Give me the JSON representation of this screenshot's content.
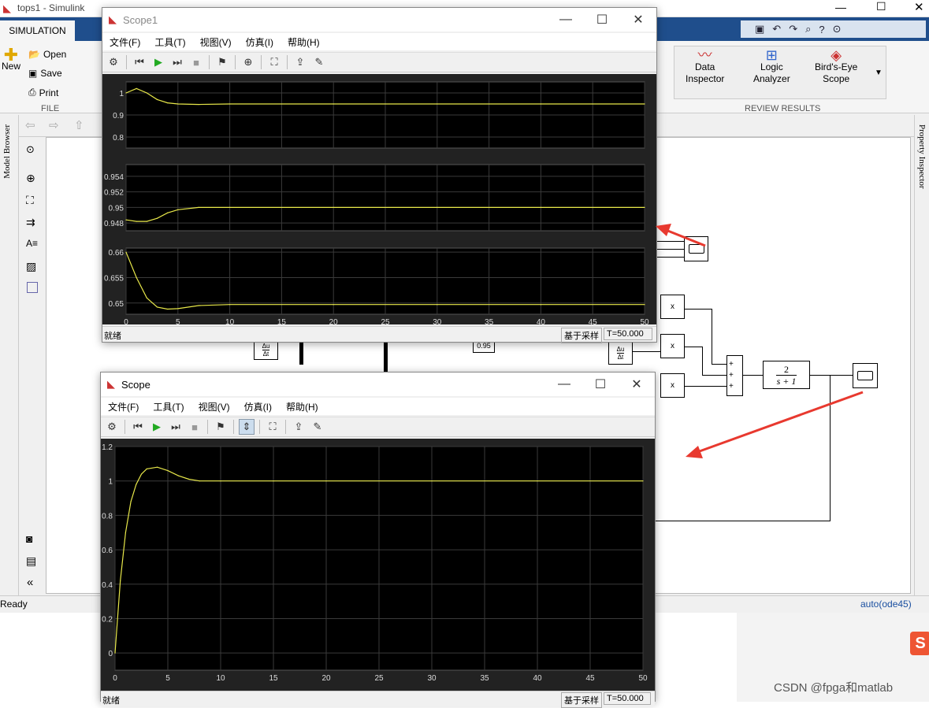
{
  "app": {
    "title": "tops1 - Simulink",
    "tab": "SIMULATION",
    "file_group": "FILE",
    "review_group": "REVIEW RESULTS",
    "new_label": "New",
    "open_label": "Open",
    "save_label": "Save",
    "print_label": "Print",
    "review_buttons": [
      {
        "label_line1": "Data",
        "label_line2": "Inspector"
      },
      {
        "label_line1": "Logic",
        "label_line2": "Analyzer"
      },
      {
        "label_line1": "Bird's-Eye",
        "label_line2": "Scope"
      }
    ],
    "left_panel_label": "Model Browser",
    "right_panel_label": "Property Inspector",
    "status_left": "Ready",
    "status_right": "auto(ode45)"
  },
  "model": {
    "gain_value": "0.95",
    "product_label": "x",
    "sum_signs": [
      "+",
      "+",
      "+"
    ],
    "tf_numerator": "2",
    "tf_denominator": "s + 1",
    "deriv_num": "Δu",
    "deriv_den": "Δt"
  },
  "scope1": {
    "title": "Scope1",
    "menu": [
      "文件(F)",
      "工具(T)",
      "视图(V)",
      "仿真(I)",
      "帮助(H)"
    ],
    "status_left": "就绪",
    "status_mode": "基于采样",
    "status_time": "T=50.000"
  },
  "scope": {
    "title": "Scope",
    "menu": [
      "文件(F)",
      "工具(T)",
      "视图(V)",
      "仿真(I)",
      "帮助(H)"
    ],
    "status_left": "就绪",
    "status_mode": "基于采样",
    "status_time": "T=50.000"
  },
  "watermark": "CSDN @fpga和matlab",
  "colors": {
    "trace": "#e8e84a",
    "plot_bg": "#000000",
    "ribbon_tab": "#1f4e8c"
  },
  "chart_data": [
    {
      "type": "line",
      "x": [
        0,
        1,
        2,
        3,
        4,
        5,
        7,
        10,
        20,
        30,
        40,
        50
      ],
      "series": [
        {
          "values": [
            1.0,
            1.02,
            1.0,
            0.97,
            0.955,
            0.95,
            0.948,
            0.95,
            0.95,
            0.95,
            0.95,
            0.95
          ]
        }
      ],
      "xlim": [
        0,
        50
      ],
      "ylim": [
        0.75,
        1.05
      ],
      "yticks": [
        "0.8",
        "0.9",
        "1"
      ],
      "xticks": [
        "0",
        "5",
        "10",
        "15",
        "20",
        "25",
        "30",
        "35",
        "40",
        "45",
        "50"
      ],
      "grid": true
    },
    {
      "type": "line",
      "x": [
        0,
        1,
        2,
        3,
        4,
        5,
        7,
        10,
        20,
        30,
        40,
        50
      ],
      "series": [
        {
          "values": [
            0.9484,
            0.9482,
            0.9482,
            0.9486,
            0.9493,
            0.9497,
            0.95,
            0.95,
            0.95,
            0.95,
            0.95,
            0.95
          ]
        }
      ],
      "xlim": [
        0,
        50
      ],
      "ylim": [
        0.947,
        0.9555
      ],
      "yticks": [
        "0.948",
        "0.95",
        "0.952",
        "0.954"
      ],
      "xticks": [
        "0",
        "5",
        "10",
        "15",
        "20",
        "25",
        "30",
        "35",
        "40",
        "45",
        "50"
      ],
      "grid": true
    },
    {
      "type": "line",
      "x": [
        0,
        1,
        2,
        3,
        4,
        5,
        7,
        10,
        20,
        30,
        40,
        50
      ],
      "series": [
        {
          "values": [
            0.66,
            0.655,
            0.651,
            0.6492,
            0.6488,
            0.6489,
            0.6495,
            0.6497,
            0.6497,
            0.6497,
            0.6497,
            0.6497
          ]
        }
      ],
      "xlim": [
        0,
        50
      ],
      "ylim": [
        0.6478,
        0.6608
      ],
      "yticks": [
        "0.65",
        "0.655",
        "0.66"
      ],
      "xticks": [
        "0",
        "5",
        "10",
        "15",
        "20",
        "25",
        "30",
        "35",
        "40",
        "45",
        "50"
      ],
      "grid": true
    },
    {
      "type": "line",
      "x": [
        0,
        0.5,
        1,
        1.5,
        2,
        2.5,
        3,
        4,
        5,
        6,
        7,
        8,
        10,
        15,
        20,
        30,
        40,
        50
      ],
      "series": [
        {
          "values": [
            0,
            0.42,
            0.7,
            0.88,
            0.98,
            1.04,
            1.07,
            1.08,
            1.06,
            1.03,
            1.01,
            1.0,
            1.0,
            1.0,
            1.0,
            1.0,
            1.0,
            1.0
          ]
        }
      ],
      "xlim": [
        0,
        50
      ],
      "ylim": [
        -0.1,
        1.2
      ],
      "yticks": [
        "0",
        "0.2",
        "0.4",
        "0.6",
        "0.8",
        "1",
        "1.2"
      ],
      "xticks": [
        "0",
        "5",
        "10",
        "15",
        "20",
        "25",
        "30",
        "35",
        "40",
        "45",
        "50"
      ],
      "grid": true
    }
  ]
}
